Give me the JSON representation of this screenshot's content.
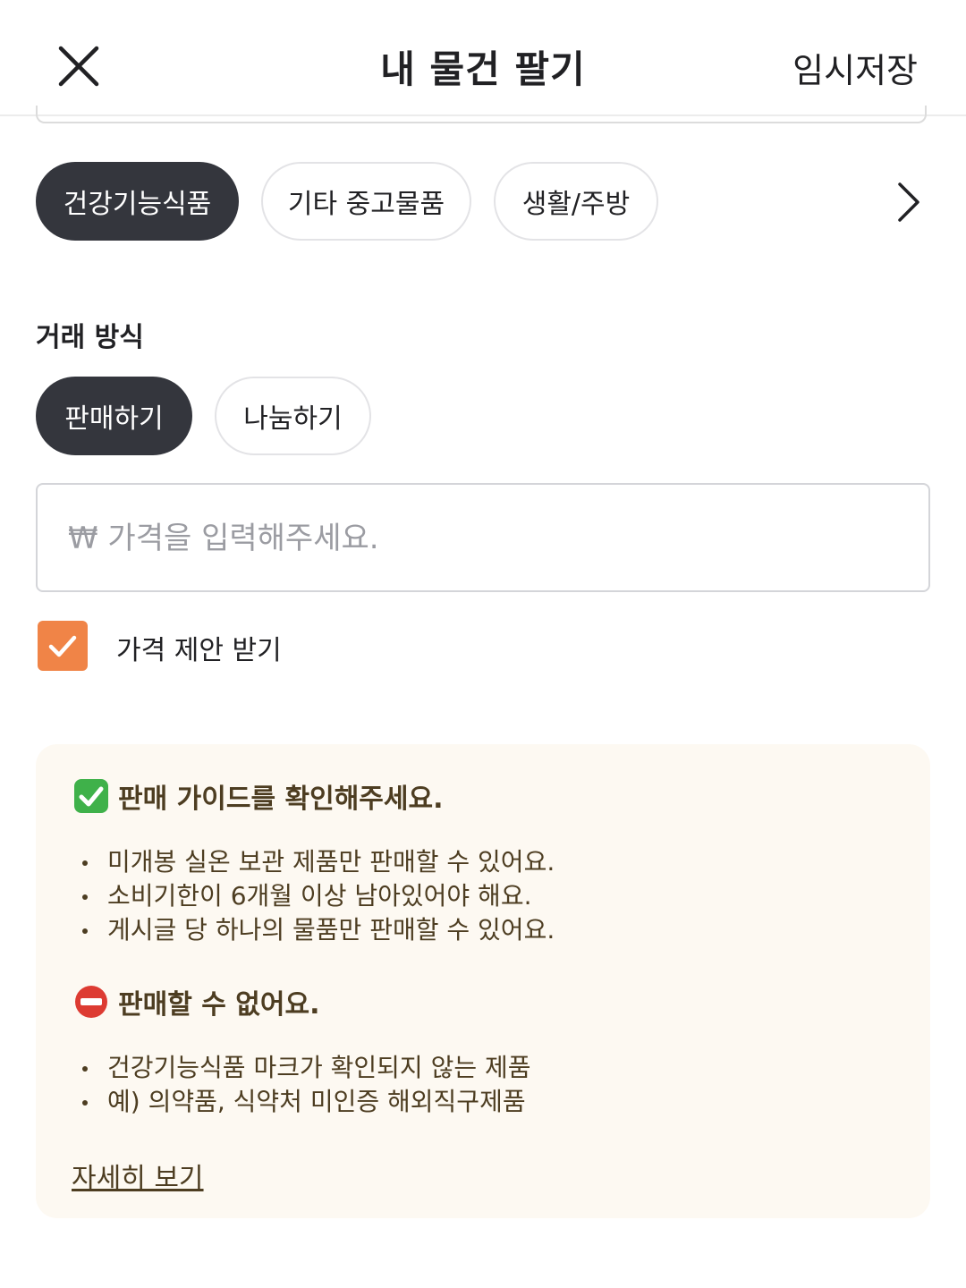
{
  "header": {
    "title": "내 물건 팔기",
    "save_label": "임시저장",
    "close_icon": "close-icon"
  },
  "categories": [
    {
      "label": "건강기능식품",
      "selected": true
    },
    {
      "label": "기타 중고물품",
      "selected": false
    },
    {
      "label": "생활/주방",
      "selected": false
    }
  ],
  "trade": {
    "label": "거래 방식",
    "options": [
      {
        "label": "판매하기",
        "selected": true
      },
      {
        "label": "나눔하기",
        "selected": false
      }
    ]
  },
  "price": {
    "placeholder": "₩ 가격을 입력해주세요.",
    "value": ""
  },
  "offer": {
    "label": "가격 제안 받기",
    "checked": true
  },
  "guide": {
    "check_heading": "판매 가이드를 확인해주세요.",
    "check_items": [
      "미개봉 실온 보관 제품만 판매할 수 있어요.",
      "소비기한이 6개월 이상 남아있어야 해요.",
      "게시글 당 하나의 물품만 판매할 수 있어요."
    ],
    "no_heading": "판매할 수 없어요.",
    "no_items": [
      "건강기능식품 마크가 확인되지 않는 제품",
      "예) 의약품, 식약처 미인증 해외직구제품"
    ],
    "more_link": "자세히 보기"
  },
  "colors": {
    "accent": "#f08447",
    "selected_chip": "#34363d",
    "guide_bg": "#fdf9f2",
    "guide_text": "#4d3d21",
    "check_emoji": "#3fb14a",
    "no_entry": "#dd3b32"
  }
}
